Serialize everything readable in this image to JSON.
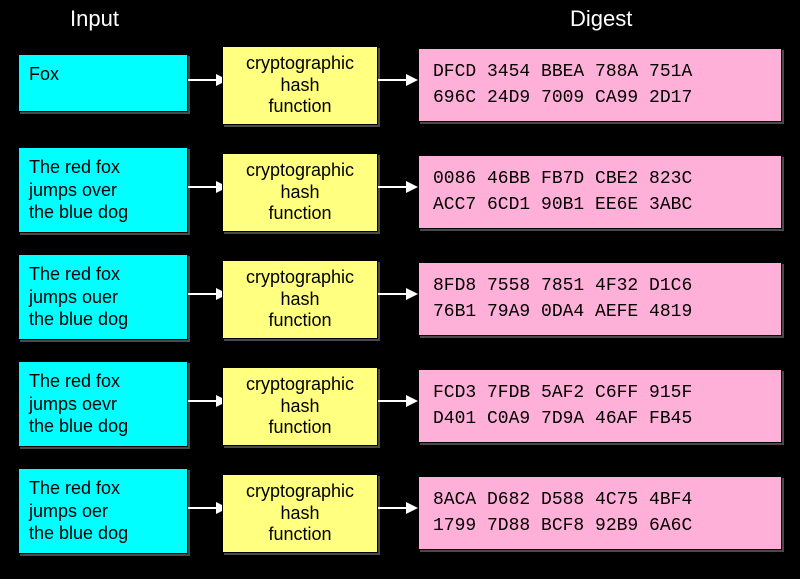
{
  "headers": {
    "input": "Input",
    "digest": "Digest"
  },
  "func_label": "cryptographic\nhash\nfunction",
  "rows": [
    {
      "input_html": "Fox",
      "input_lines": 1,
      "hash": "DFCD 3454 BBEA 788A 751A\n696C 24D9 7009 CA99 2D17"
    },
    {
      "input_html": "The red fox<br>jumps over<br>the blue dog",
      "input_lines": 3,
      "hash": "0086 46BB FB7D CBE2 823C\nACC7 6CD1 90B1 EE6E 3ABC"
    },
    {
      "input_html": "The red fox<br>jumps o<span class=\"hl\">u</span>er<br>the blue dog",
      "input_lines": 3,
      "hash": "8FD8 7558 7851 4F32 D1C6\n76B1 79A9 0DA4 AEFE 4819"
    },
    {
      "input_html": "The red fox<br>jumps o<span class=\"hl\">ev</span>r<br>the blue dog",
      "input_lines": 3,
      "hash": "FCD3 7FDB 5AF2 C6FF 915F\nD401 C0A9 7D9A 46AF FB45"
    },
    {
      "input_html": "The red fox<br>jumps o<span class=\"hl\">er</span><br>the blue dog",
      "input_lines": 3,
      "hash": "8ACA D682 D588 4C75 4BF4\n1799 7D88 BCF8 92B9 6A6C"
    }
  ]
}
